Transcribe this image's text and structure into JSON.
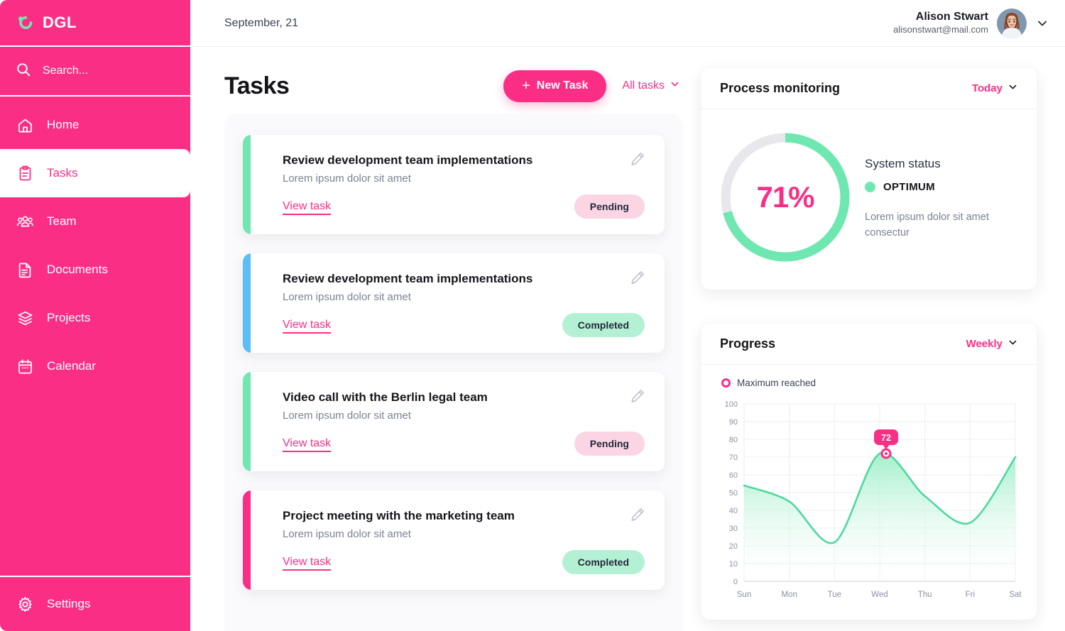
{
  "brand": {
    "name": "DGL",
    "color": "#FB2E86",
    "accent_green": "#6FE7B0"
  },
  "sidebar": {
    "search_placeholder": "Search...",
    "items": [
      {
        "label": "Home",
        "icon": "home-icon",
        "active": false
      },
      {
        "label": "Tasks",
        "icon": "clipboard-icon",
        "active": true
      },
      {
        "label": "Team",
        "icon": "people-icon",
        "active": false
      },
      {
        "label": "Documents",
        "icon": "document-icon",
        "active": false
      },
      {
        "label": "Projects",
        "icon": "layers-icon",
        "active": false
      },
      {
        "label": "Calendar",
        "icon": "calendar-icon",
        "active": false
      }
    ],
    "settings_label": "Settings"
  },
  "topbar": {
    "date": "September, 21",
    "user_name": "Alison Stwart",
    "user_email": "alisonstwart@mail.com"
  },
  "tasks": {
    "title": "Tasks",
    "new_task_label": "New Task",
    "new_task_plus": "+",
    "filter_label": "All tasks",
    "view_link_label": "View task",
    "items": [
      {
        "title": "Review development team implementations",
        "subtitle": "Lorem ipsum dolor sit amet",
        "status": "Pending",
        "accent": "#6FE7B0",
        "pill_bg": "#FBD5E4"
      },
      {
        "title": "Review development team implementations",
        "subtitle": "Lorem ipsum dolor sit amet",
        "status": "Completed",
        "accent": "#5BBEF5",
        "pill_bg": "#B4F1D4"
      },
      {
        "title": "Video call with the Berlin legal team",
        "subtitle": "Lorem ipsum dolor sit amet",
        "status": "Pending",
        "accent": "#6FE7B0",
        "pill_bg": "#FBD5E4"
      },
      {
        "title": "Project meeting with the marketing team",
        "subtitle": "Lorem ipsum dolor sit amet",
        "status": "Completed",
        "accent": "#FB2E86",
        "pill_bg": "#B4F1D4"
      }
    ]
  },
  "monitoring": {
    "title": "Process monitoring",
    "filter_label": "Today",
    "percent_label": "71%",
    "percent_value": 71,
    "status_heading": "System status",
    "status_value": "OPTIMUM",
    "status_color": "#6FE7B0",
    "description": "Lorem ipsum dolor sit amet consectur"
  },
  "progress": {
    "title": "Progress",
    "filter_label": "Weekly",
    "legend_label": "Maximum reached",
    "tooltip_value": "72"
  },
  "chart_data": {
    "type": "area",
    "title": "Progress",
    "xlabel": "",
    "ylabel": "",
    "categories": [
      "Sun",
      "Mon",
      "Tue",
      "Wed",
      "Thu",
      "Fri",
      "Sat"
    ],
    "values": [
      54,
      45,
      22,
      72,
      48,
      33,
      70
    ],
    "ylim": [
      0,
      100
    ],
    "yticks": [
      0,
      10,
      20,
      30,
      40,
      50,
      60,
      70,
      80,
      90,
      100
    ],
    "grid": true,
    "legend": [
      "Maximum reached"
    ],
    "legend_position": "top-left",
    "annotations": [
      {
        "label": "72",
        "x": "Wed",
        "y": 72,
        "type": "max-marker"
      }
    ],
    "line_color": "#4FD8A0",
    "fill_gradient": [
      "#9DEFC7",
      "#FFFFFF"
    ],
    "marker_color": "#FB2E86"
  }
}
